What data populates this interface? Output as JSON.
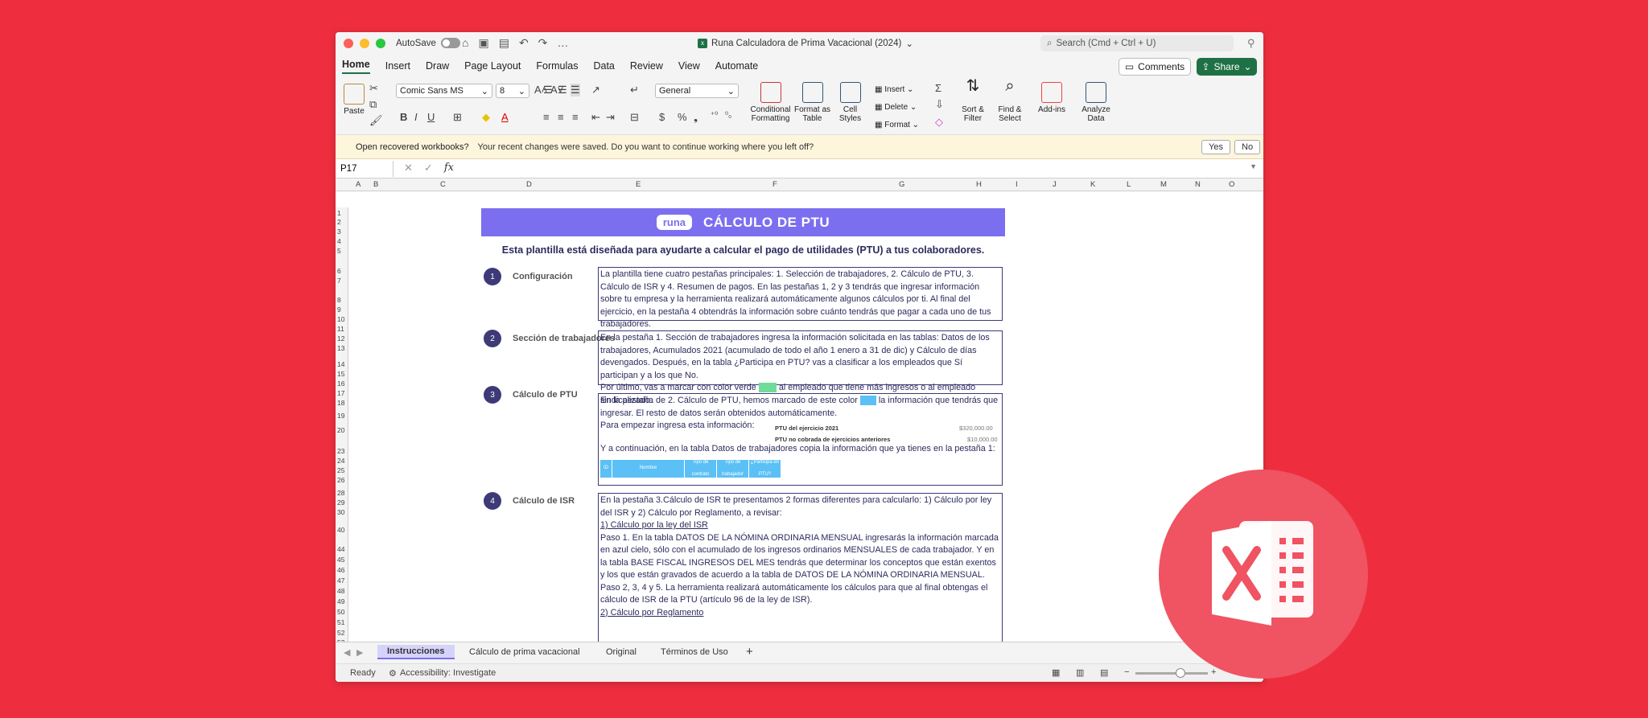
{
  "window": {
    "autosave_label": "AutoSave",
    "doc_title": "Runa Calculadora de Prima Vacacional (2024)",
    "search_placeholder": "Search (Cmd + Ctrl + U)"
  },
  "tabs": [
    "Home",
    "Insert",
    "Draw",
    "Page Layout",
    "Formulas",
    "Data",
    "Review",
    "View",
    "Automate"
  ],
  "buttons": {
    "comments": "Comments",
    "share": "Share"
  },
  "ribbon": {
    "paste": "Paste",
    "font_name": "Comic Sans MS",
    "font_size": "8",
    "number_format": "General",
    "conditional": "Conditional Formatting",
    "format_table": "Format as Table",
    "cell_styles": "Cell Styles",
    "insert": "Insert",
    "delete": "Delete",
    "format": "Format",
    "sort_filter": "Sort & Filter",
    "find_select": "Find & Select",
    "addins": "Add-ins",
    "analyze": "Analyze Data",
    "bold": "B",
    "italic": "I",
    "underline": "U"
  },
  "recover": {
    "title": "Open recovered workbooks?",
    "message": "Your recent changes were saved. Do you want to continue working where you left off?",
    "yes": "Yes",
    "no": "No"
  },
  "formula_bar": {
    "cell_ref": "P17",
    "fx": "fx"
  },
  "columns": [
    "A",
    "B",
    "C",
    "D",
    "E",
    "F",
    "G",
    "H",
    "I",
    "J",
    "K",
    "L",
    "M",
    "N",
    "O"
  ],
  "rows": [
    "1",
    "2",
    "3",
    "4",
    "5",
    "6",
    "7",
    "8",
    "9",
    "10",
    "11",
    "12",
    "13",
    "14",
    "15",
    "16",
    "17",
    "18",
    "19",
    "20",
    "23",
    "24",
    "25",
    "26",
    "28",
    "29",
    "30",
    "40",
    "44",
    "45",
    "46",
    "47",
    "48",
    "49",
    "50",
    "51",
    "52",
    "53"
  ],
  "sheet": {
    "banner_logo": "runa",
    "banner_title": "CÁLCULO DE PTU",
    "subtitle": "Esta plantilla está diseñada para ayudarte a calcular el pago de utilidades (PTU) a tus colaboradores.",
    "steps": [
      {
        "num": "1",
        "label": "Configuración"
      },
      {
        "num": "2",
        "label": "Sección de trabajadores"
      },
      {
        "num": "3",
        "label": "Cálculo de PTU"
      },
      {
        "num": "4",
        "label": "Cálculo de ISR"
      }
    ],
    "box1": "La plantilla tiene cuatro pestañas principales: 1. Selección de trabajadores, 2. Cálculo de PTU, 3. Cálculo de ISR y 4. Resumen de pagos. En las pestañas 1, 2 y 3 tendrás que ingresar información sobre tu empresa y la herramienta realizará automáticamente algunos cálculos por ti. Al final del ejercicio, en la pestaña 4 obtendrás la información sobre cuánto tendrás que pagar a cada uno de tus trabajadores.",
    "box2a": "En la pestaña 1. Sección de trabajadores ingresa la información solicitada en las tablas: Datos de los trabajadores, Acumulados 2021 (acumulado de todo el año 1 enero a 31 de dic) y Cálculo de días devengados. Después, en la tabla ¿Participa en PTU? vas a clasificar a los empleados que Sí participan y a los que No.",
    "box2b_pre": "Por último, vas a marcar con color verde",
    "box2b_post": "al empleado que tiene más ingresos o al empleado sindicalizado.",
    "box3a_pre": "En la pestaña de 2. Cálculo de PTU, hemos marcado de este color",
    "box3a_post": "la información que tendrás que ingresar. El resto de datos serán obtenidos automáticamente.",
    "box3b": "Para empezar ingresa esta información:",
    "ptu_label1": "PTU del ejercicio 2021",
    "ptu_val1": "$320,000.00",
    "ptu_label2": "PTU no cobrada de ejercicios anteriores",
    "ptu_val2": "$10,000.00",
    "box3c": "Y a continuación, en la tabla Datos de trabajadores copia la información que ya tienes en la pestaña 1:",
    "mini_headers": [
      "ID",
      "Nombre",
      "Tipo de contrato",
      "Tipo de trabajador",
      "¿Participa en PTU?"
    ],
    "box4_l1": "En la pestaña 3.Cálculo de ISR te presentamos 2 formas diferentes para calcularlo: 1) Cálculo por ley del ISR y 2) Cálculo por Reglamento, a revisar:",
    "box4_l2": "1) Cálculo por la ley del ISR",
    "box4_l3": "Paso 1. En la tabla DATOS DE LA NÓMINA ORDINARIA MENSUAL ingresarás la información marcada en azul cielo, sólo con el acumulado de los ingresos ordinarios MENSUALES de cada trabajador. Y en la tabla BASE FISCAL INGRESOS DEL MES tendrás que determinar los conceptos que están exentos y los que están gravados de acuerdo a la tabla de DATOS DE LA NÓMINA ORDINARIA MENSUAL.",
    "box4_l4": "Paso 2, 3, 4 y 5. La herramienta realizará automáticamente los cálculos para que al final obtengas el cálculo de ISR de la PTU (artículo 96 de la ley de ISR).",
    "box4_l5": "2) Cálculo por Reglamento"
  },
  "sheet_tabs": [
    "Instrucciones",
    "Cálculo de prima vacacional",
    "Original",
    "Términos de Uso"
  ],
  "status": {
    "ready": "Ready",
    "accessibility": "Accessibility: Investigate"
  },
  "colors": {
    "accent": "#1e7145",
    "banner": "#7b6ff0",
    "background": "#ee2e3f"
  }
}
